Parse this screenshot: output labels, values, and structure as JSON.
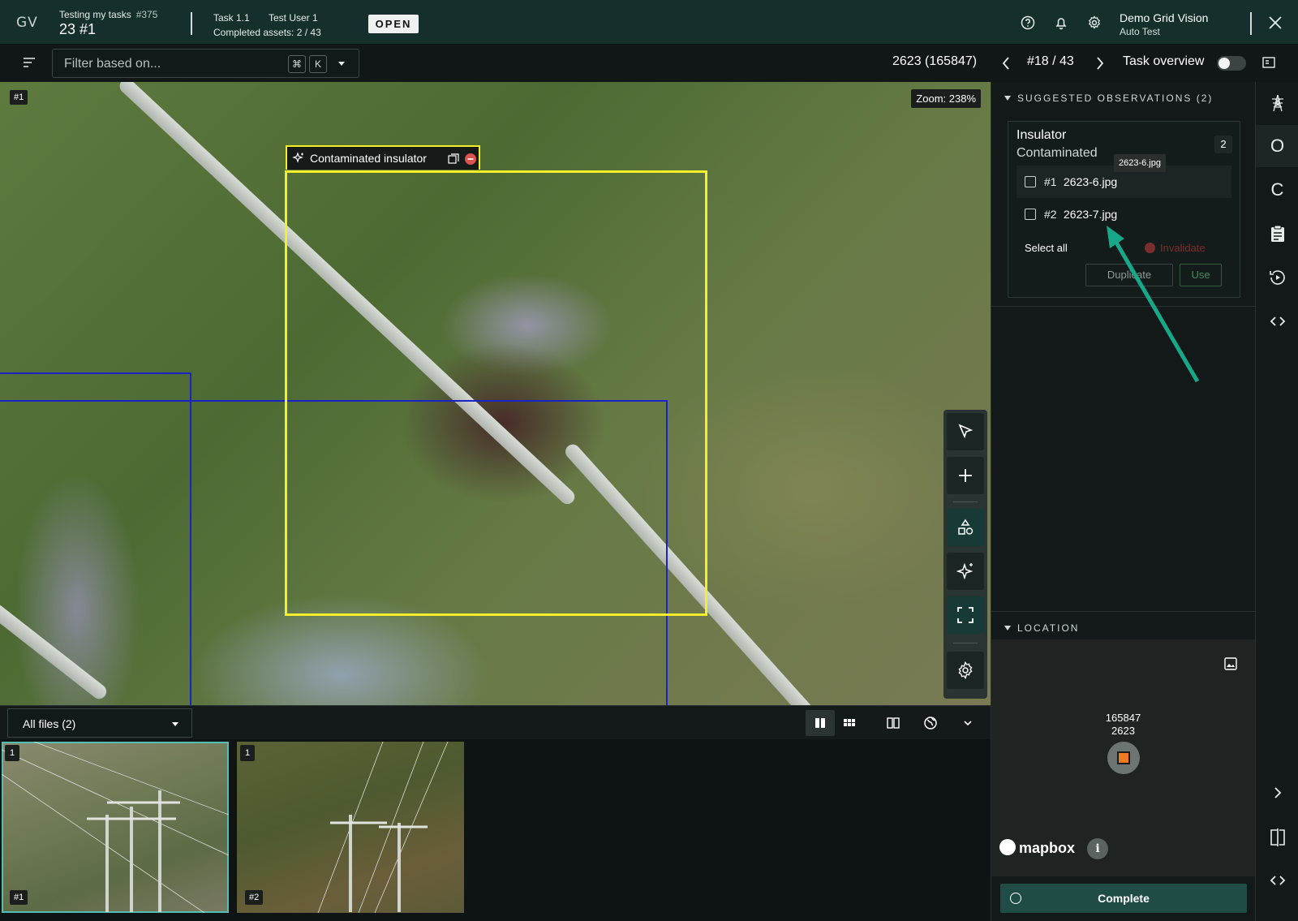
{
  "header": {
    "logo": "GV",
    "task_title": "Testing my tasks",
    "task_code": "#375",
    "task_number": "23 #1",
    "task_sub": "Task 1.1",
    "assignee": "Test User 1",
    "completed_assets": "Completed assets: 2 / 43",
    "status": "OPEN",
    "org_name": "Demo Grid Vision",
    "org_user": "Auto Test",
    "icons": [
      "help-icon",
      "bell-icon",
      "gear-icon",
      "close-icon"
    ]
  },
  "toolbar": {
    "filter_placeholder": "Filter based on...",
    "shortcut_cmd": "⌘",
    "shortcut_key": "K",
    "asset_id": "2623 (165847)",
    "pager": "#18 / 43",
    "task_overview_label": "Task overview",
    "task_overview_on": false
  },
  "canvas": {
    "image_tag": "#1",
    "zoom_label": "Zoom: 238%",
    "annotation_label": "Contaminated insulator",
    "annotation_color": "#f4ee2b",
    "secondary_box_color": "#1a22c8",
    "tools": [
      "select-tool",
      "add-tool",
      "shapes-tool",
      "ai-suggest-tool",
      "fit-screen-tool",
      "settings-tool"
    ]
  },
  "files": {
    "selector_value": "All files (2)",
    "thumbnails": [
      {
        "tag": "1",
        "num": "#1",
        "selected": true
      },
      {
        "tag": "1",
        "num": "#2",
        "selected": false
      }
    ]
  },
  "suggested": {
    "header": "SUGGESTED OBSERVATIONS (2)",
    "card_title": "Insulator",
    "card_subtitle": "Contaminated",
    "count": "2",
    "tooltip": "2623-6.jpg",
    "rows": [
      {
        "idx": "#1",
        "file": "2623-6.jpg"
      },
      {
        "idx": "#2",
        "file": "2623-7.jpg"
      }
    ],
    "select_all": "Select all",
    "invalidate": "Invalidate",
    "duplicate": "Duplicate",
    "use": "Use"
  },
  "location": {
    "header": "LOCATION",
    "pin_id": "165847",
    "pin_sub": "2623",
    "attribution": "mapbox",
    "info": "i"
  },
  "complete_label": "Complete",
  "rail": {
    "items": [
      "tower-icon",
      "O",
      "C",
      "clipboard-icon",
      "history-icon",
      "code-icon",
      "chevron-right-icon",
      "split-view-icon",
      "code-icon"
    ]
  }
}
